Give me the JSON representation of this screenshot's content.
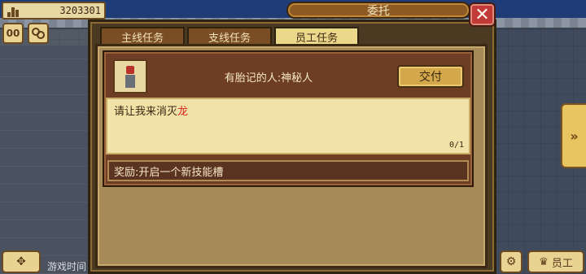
{
  "hud": {
    "money": "3203301",
    "pause_label": "00",
    "game_time_label": "游戏时间"
  },
  "dialog": {
    "title": "委托",
    "close_symbol": "✕"
  },
  "tabs": [
    {
      "label": "主线任务",
      "active": false
    },
    {
      "label": "支线任务",
      "active": false
    },
    {
      "label": "员工任务",
      "active": true
    }
  ],
  "quest": {
    "npc_name": "有胎记的人:神秘人",
    "submit_label": "交付",
    "request_prefix": "请让我来消灭",
    "request_target": "龙",
    "progress": "0/1",
    "reward": "奖励:开启一个新技能槽"
  },
  "bottom_bar": {
    "staff_label": "员工"
  },
  "colors": {
    "target_highlight": "#d8231c",
    "panel_brown": "#6e3e24",
    "close_red": "#c23a38"
  },
  "icons": [
    "bar-chart-icon",
    "pause-icon",
    "fast-forward-icon",
    "move-icon",
    "gear-icon",
    "staff-icon"
  ]
}
